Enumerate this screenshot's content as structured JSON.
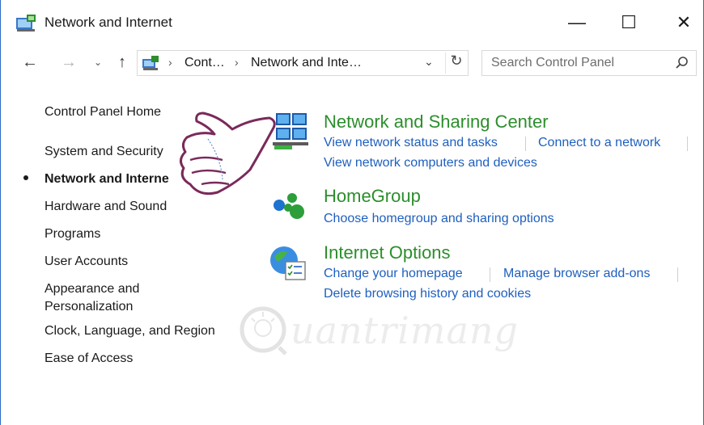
{
  "window": {
    "title": "Network and Internet",
    "minimize_glyph": "—",
    "maximize_glyph": "☐",
    "close_glyph": "✕"
  },
  "nav": {
    "back_glyph": "←",
    "forward_glyph": "→",
    "recent_glyph": "⌄",
    "up_glyph": "↑",
    "refresh_glyph": "↻",
    "dropdown_glyph": "⌄"
  },
  "address": {
    "separator": "›",
    "crumbs": [
      "Cont…",
      "Network and Inte…"
    ]
  },
  "search": {
    "placeholder": "Search Control Panel",
    "icon": "search-icon"
  },
  "sidebar": {
    "items": [
      {
        "label": "Control Panel Home",
        "active": false
      },
      {
        "label": "System and Security",
        "active": false
      },
      {
        "label": "Network and Interne",
        "active": true
      },
      {
        "label": "Hardware and Sound",
        "active": false
      },
      {
        "label": "Programs",
        "active": false
      },
      {
        "label": "User Accounts",
        "active": false
      },
      {
        "label": "Appearance and",
        "active": false
      },
      {
        "label": "Personalization",
        "active": false
      },
      {
        "label": "Clock, Language, and Region",
        "active": false
      },
      {
        "label": "Ease of Access",
        "active": false
      }
    ]
  },
  "categories": [
    {
      "title": "Network and Sharing Center",
      "icon": "network-sharing-icon",
      "links": [
        "View network status and tasks",
        "Connect to a network",
        "View network computers and devices"
      ]
    },
    {
      "title": "HomeGroup",
      "icon": "homegroup-icon",
      "links": [
        "Choose homegroup and sharing options"
      ]
    },
    {
      "title": "Internet Options",
      "icon": "internet-options-icon",
      "links": [
        "Change your homepage",
        "Manage browser add-ons",
        "Delete browsing history and cookies"
      ]
    }
  ],
  "watermark": {
    "text": "uantrimang"
  },
  "colors": {
    "category_title": "#2c8e2c",
    "link": "#1e5fbf",
    "window_border": "#2b6cc4"
  }
}
